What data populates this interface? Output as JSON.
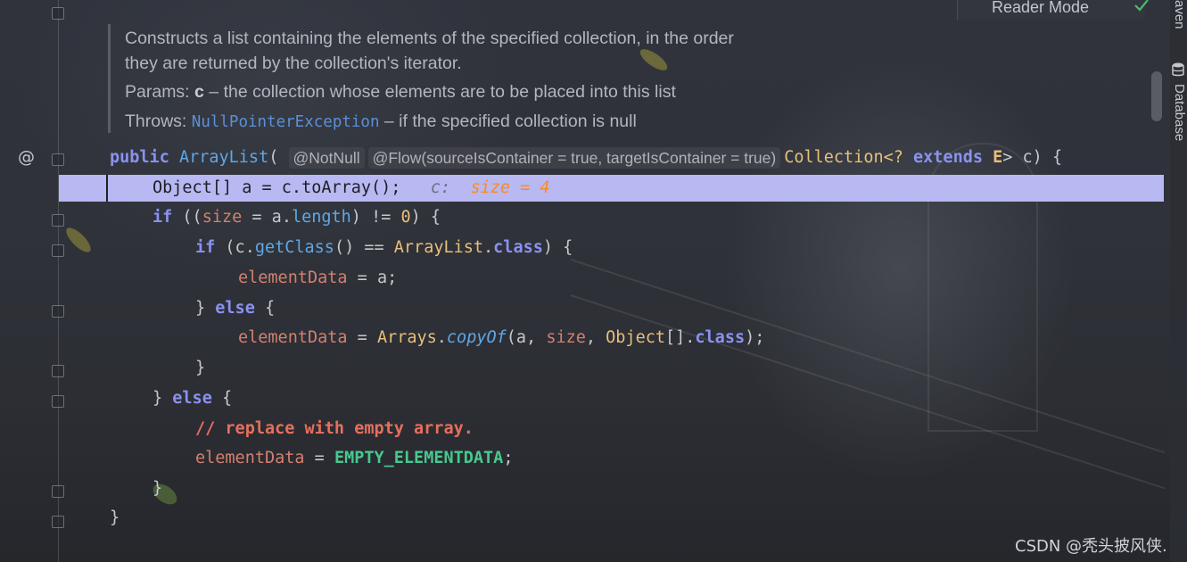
{
  "top_bar": {
    "reader_mode_label": "Reader Mode",
    "status_icon": "check-icon",
    "status_color": "#4cbb6c"
  },
  "right_tool_strip": {
    "maven_label": "aven",
    "database_label": "Database",
    "database_icon": "database-icon"
  },
  "gutter": {
    "override_marker": "@",
    "fold_icon": "fold-marker-icon"
  },
  "javadoc": {
    "line1": "Constructs a list containing the elements of the specified collection, in the order",
    "line2": "they are returned by the collection's iterator.",
    "params_label": "Params:",
    "params_name": "c",
    "params_desc": " – the collection whose elements are to be placed into this list",
    "throws_label": "Throws:",
    "throws_type": "NullPointerException",
    "throws_desc": " – if the specified collection is null"
  },
  "code": {
    "sig_public": "public",
    "sig_name": "ArrayList",
    "sig_paren": "(",
    "sig_hint_notnull": "@NotNull",
    "sig_hint_flow": "@Flow(sourceIsContainer = true, targetIsContainer = true)",
    "sig_type": "Collection<? ",
    "sig_extends": "extends",
    "sig_generic": " E",
    "sig_rest": "> c) {",
    "l2_code": "Object[] a = c.toArray();",
    "l2_inline_label": "c:",
    "l2_inline_value": "size = 4",
    "l3_if": "if",
    "l3_a": " ((",
    "l3_size": "size",
    "l3_b": " = a.",
    "l3_length": "length",
    "l3_c": ") != ",
    "l3_zero": "0",
    "l3_d": ") {",
    "l4_if": "if",
    "l4_a": " (c.",
    "l4_getclass": "getClass",
    "l4_b": "() == ",
    "l4_arraylist": "ArrayList",
    "l4_c": ".",
    "l4_class": "class",
    "l4_d": ") {",
    "l5_field": "elementData",
    "l5_rest": " = a;",
    "l6_brace": "} ",
    "l6_else": "else",
    "l6_rest": " {",
    "l7_field": "elementData",
    "l7_a": " = ",
    "l7_arrays": "Arrays",
    "l7_b": ".",
    "l7_copyof": "copyOf",
    "l7_c": "(a, ",
    "l7_size": "size",
    "l7_d": ", ",
    "l7_object": "Object",
    "l7_e": "[].",
    "l7_class": "class",
    "l7_f": ");",
    "l8_brace": "}",
    "l9_brace": "} ",
    "l9_else": "else",
    "l9_rest": " {",
    "l10_comment": "// replace with empty array.",
    "l11_field": "elementData",
    "l11_a": " = ",
    "l11_const": "EMPTY_ELEMENTDATA",
    "l11_b": ";",
    "l12_brace": "}",
    "l13_brace": "}"
  },
  "watermark": "CSDN @秃头披风侠."
}
